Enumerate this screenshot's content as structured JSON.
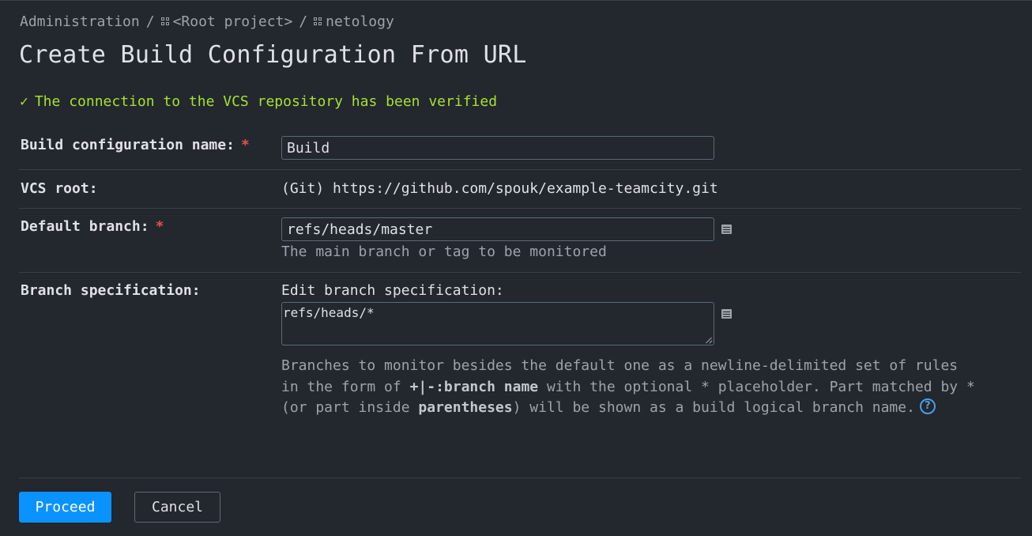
{
  "breadcrumb": {
    "items": [
      {
        "label": "Administration",
        "icon": "none"
      },
      {
        "label": "<Root project>",
        "icon": "project-icon"
      },
      {
        "label": "netology",
        "icon": "project-icon"
      }
    ],
    "separator": "/"
  },
  "page_title": "Create Build Configuration From URL",
  "verification": {
    "icon": "checkmark-icon",
    "check_glyph": "✓",
    "message": "The connection to the VCS repository has been verified",
    "color": "#a6e22e"
  },
  "form": {
    "build_name": {
      "label": "Build configuration name:",
      "required_mark": "*",
      "value": "Build"
    },
    "vcs_root": {
      "label": "VCS root:",
      "value": "(Git) https://github.com/spouk/example-teamcity.git"
    },
    "default_branch": {
      "label": "Default branch:",
      "required_mark": "*",
      "value": "refs/heads/master",
      "hint": "The main branch or tag to be monitored"
    },
    "branch_spec": {
      "label": "Branch specification:",
      "edit_label": "Edit branch specification:",
      "value": "refs/heads/*",
      "hint_part1": "Branches to monitor besides the default one as a newline-delimited set of rules in the form of ",
      "hint_bold1": "+|-:branch name",
      "hint_part2": " with the optional * placeholder. Part matched by * (or part inside ",
      "hint_bold2": "parentheses",
      "hint_part3": ") will be shown as a build logical branch name.",
      "help_glyph": "?"
    }
  },
  "buttons": {
    "proceed": "Proceed",
    "cancel": "Cancel"
  },
  "colors": {
    "background": "#23272e",
    "accent": "#0a92ff",
    "required": "#e5534b",
    "success": "#a6e22e"
  }
}
